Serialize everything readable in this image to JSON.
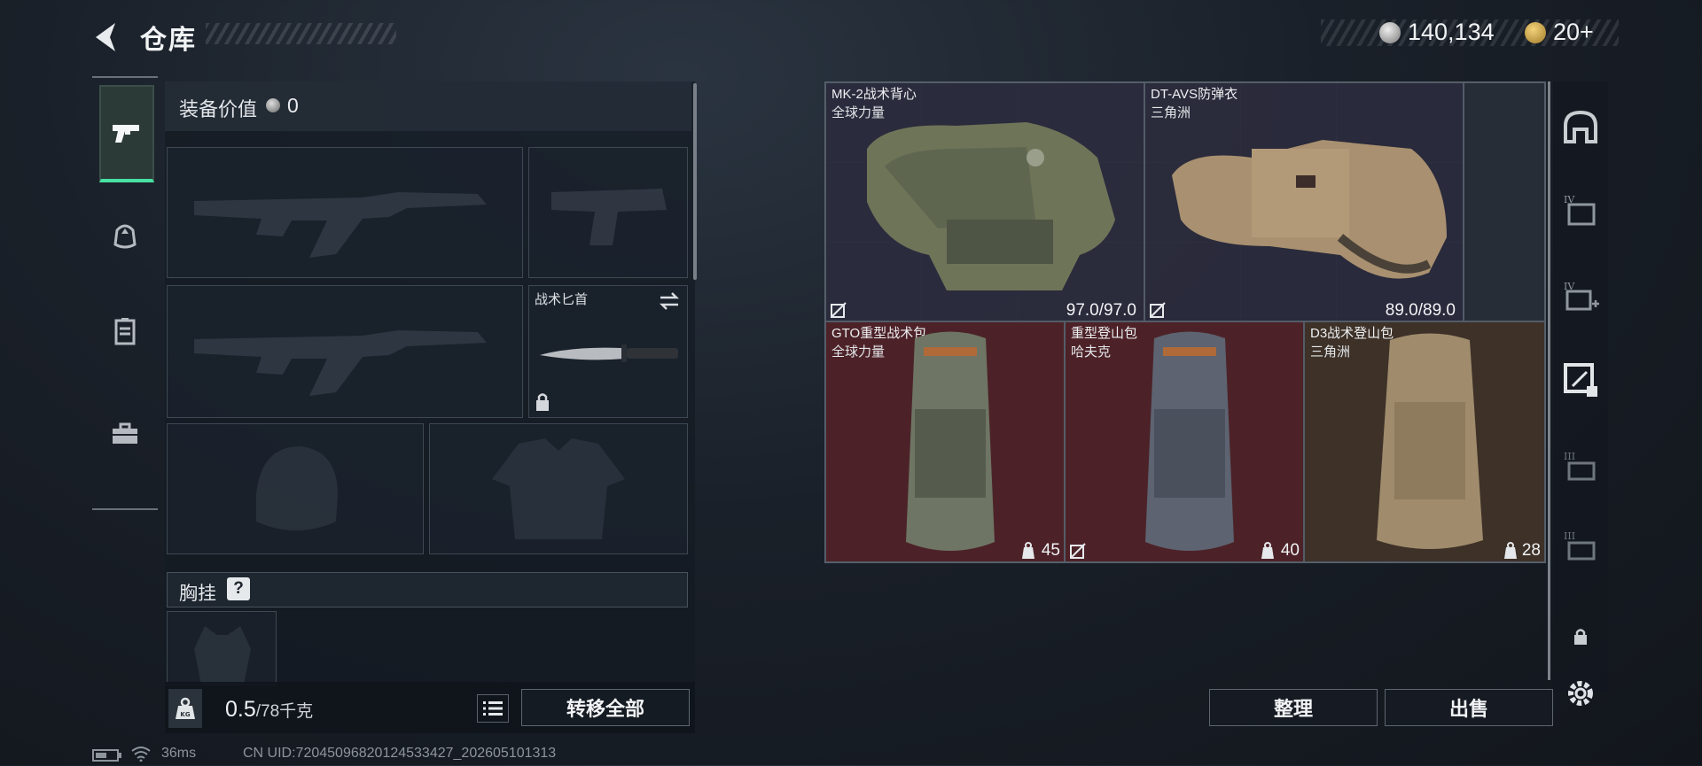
{
  "header": {
    "title": "仓库",
    "back_icon": "back-arrow-icon"
  },
  "currency": [
    {
      "icon": "silver-coin-icon",
      "value": "140,134"
    },
    {
      "icon": "gold-coin-icon",
      "value": "20+"
    }
  ],
  "left_tabs": [
    {
      "icon": "pistol-icon",
      "active": true
    },
    {
      "icon": "helmet-icon",
      "active": false
    },
    {
      "icon": "locker-icon",
      "active": false
    },
    {
      "icon": "toolbox-icon",
      "active": false
    }
  ],
  "loadout": {
    "equip_value_label": "装备价值",
    "equip_value": "0",
    "melee_slot_label": "战术匕首",
    "chest_rig_label": "胸挂",
    "chest_rig_help": "?",
    "weight_value": "0.5",
    "weight_max": "/78千克",
    "transfer_all_label": "转移全部"
  },
  "storage": {
    "items": [
      {
        "name": "MK-2战术背心",
        "sub": "全球力量",
        "value": "97.0/97.0",
        "type": "vest"
      },
      {
        "name": "DT-AVS防弹衣",
        "sub": "三角洲",
        "value": "89.0/89.0",
        "type": "vest"
      },
      {
        "name": "GTO重型战术包",
        "sub": "全球力量",
        "value": "45",
        "type": "bag"
      },
      {
        "name": "重型登山包",
        "sub": "哈夫克",
        "value": "40",
        "type": "bag"
      },
      {
        "name": "D3战术登山包",
        "sub": "三角洲",
        "value": "28",
        "type": "bag"
      }
    ],
    "organize_label": "整理",
    "sell_label": "出售"
  },
  "right_rail": [
    {
      "icon": "helmet-outline-icon"
    },
    {
      "icon": "storage-box-iv-icon"
    },
    {
      "icon": "storage-box-iv-add-icon"
    },
    {
      "icon": "grid-expand-icon"
    },
    {
      "icon": "storage-box-iii-icon"
    },
    {
      "icon": "storage-box-iii-alt-icon"
    },
    {
      "icon": "lock-icon"
    },
    {
      "icon": "settings-gear-icon"
    }
  ],
  "status_bar": {
    "ping": "36ms",
    "uid": "CN UID:72045096820124533427_202605101313"
  },
  "colors": {
    "accent": "#48e0a3",
    "vest_bg": "#2b2b3d",
    "bag_red": "#4c2228",
    "bag_brown": "#3d3128"
  }
}
